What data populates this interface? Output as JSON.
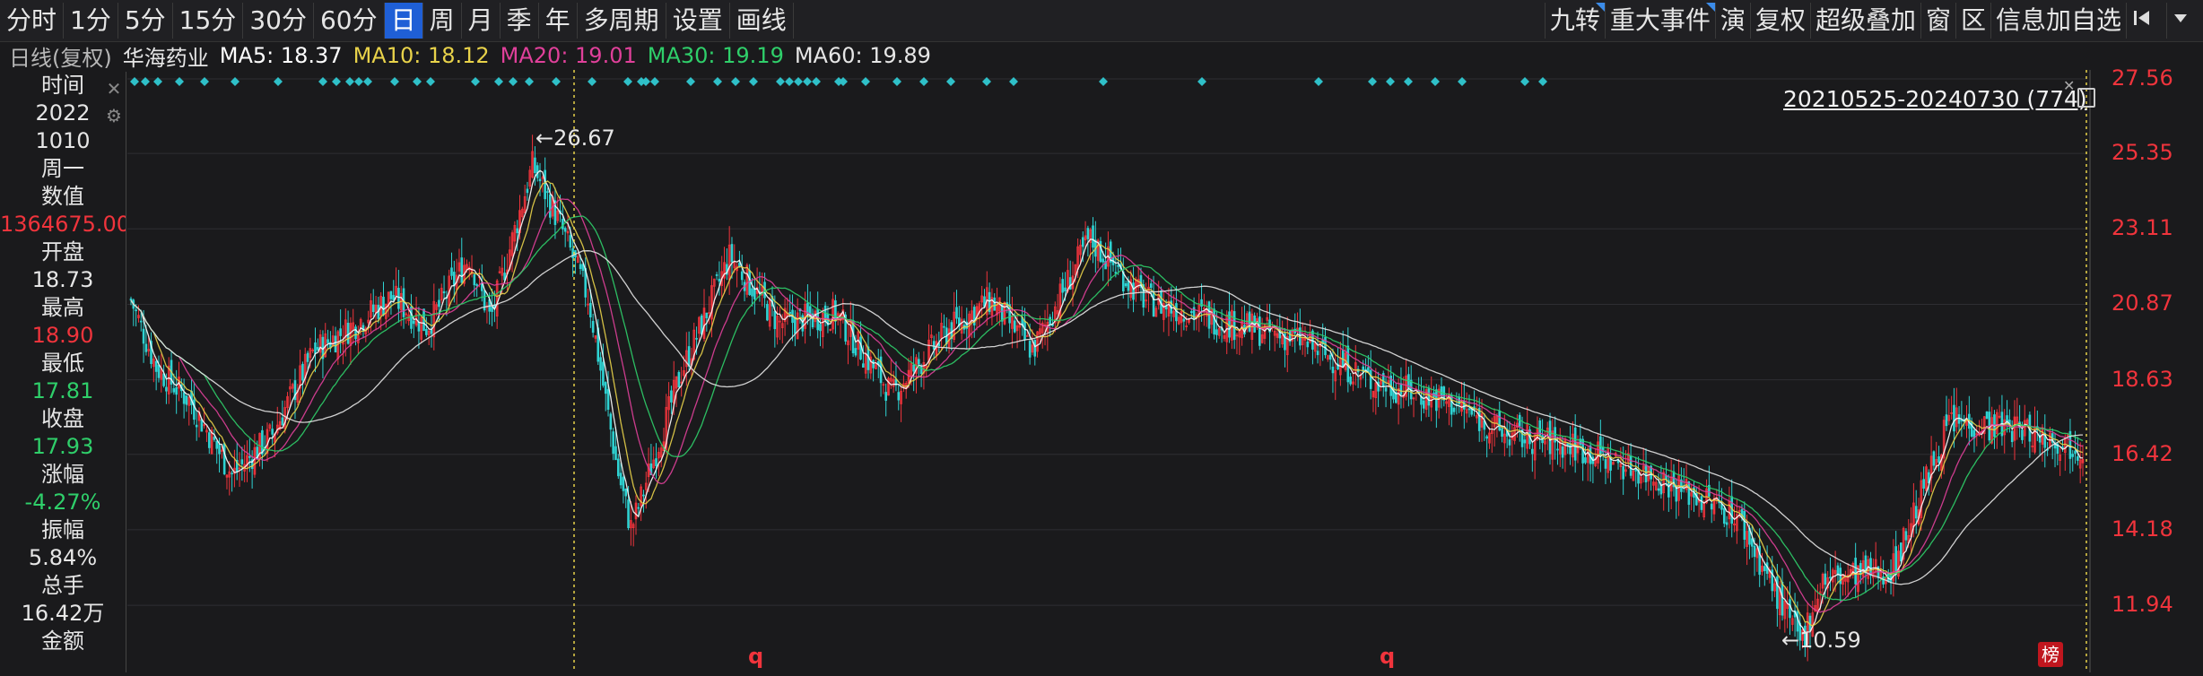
{
  "toolbar": {
    "left": [
      "分时",
      "1分",
      "5分",
      "15分",
      "30分",
      "60分",
      "日",
      "周",
      "月",
      "季",
      "年",
      "多周期",
      "设置",
      "画线"
    ],
    "active": "日",
    "right": [
      "九转",
      "重大事件",
      "演",
      "复权",
      "超级叠加",
      "窗",
      "区",
      "信息加自选"
    ]
  },
  "maline": {
    "period": "日线(复权)",
    "stock": "华海药业",
    "ma5": "MA5: 18.37",
    "ma10": "MA10: 18.12",
    "ma20": "MA20: 19.01",
    "ma30": "MA30: 19.19",
    "ma60": "MA60: 19.89"
  },
  "panel": {
    "time_label": "时间",
    "year": "2022",
    "date": "1010",
    "weekday": "周一",
    "value_label": "数值",
    "value": "1364675.00",
    "open_label": "开盘",
    "open": "18.73",
    "high_label": "最高",
    "high": "18.90",
    "low_label": "最低",
    "low": "17.81",
    "close_label": "收盘",
    "close": "17.93",
    "change_label": "涨幅",
    "change": "-4.27%",
    "amplitude_label": "振幅",
    "amplitude": "5.84%",
    "volume_label": "总手",
    "volume": "16.42万",
    "amount_label": "金额"
  },
  "range_label": "20210525-20240730 (774)",
  "annotations": {
    "high": "26.67",
    "low": "10.59"
  },
  "markers": {
    "q": "q",
    "bang": "榜"
  },
  "colors": {
    "up": "#f0343c",
    "down": "#2fd3d3",
    "ma5": "#ffffff",
    "ma10": "#e8d24a",
    "ma20": "#e0409a",
    "ma30": "#2fcf6a",
    "ma60": "#e6e6e6"
  },
  "chart_data": {
    "type": "candlestick",
    "ylim": [
      10.0,
      27.56
    ],
    "yticks": [
      27.56,
      25.35,
      23.11,
      20.87,
      18.63,
      16.42,
      14.18,
      11.94
    ],
    "points": [
      {
        "x": 0,
        "y": 21.0
      },
      {
        "x": 18,
        "y": 19.0
      },
      {
        "x": 42,
        "y": 18.0
      },
      {
        "x": 72,
        "y": 15.8
      },
      {
        "x": 100,
        "y": 17.0
      },
      {
        "x": 130,
        "y": 19.5
      },
      {
        "x": 160,
        "y": 20.3
      },
      {
        "x": 185,
        "y": 21.1
      },
      {
        "x": 210,
        "y": 20.2
      },
      {
        "x": 240,
        "y": 22.3
      },
      {
        "x": 255,
        "y": 20.4
      },
      {
        "x": 285,
        "y": 25.0
      },
      {
        "x": 305,
        "y": 23.2
      },
      {
        "x": 325,
        "y": 21.0
      },
      {
        "x": 345,
        "y": 16.0
      },
      {
        "x": 355,
        "y": 14.2
      },
      {
        "x": 390,
        "y": 18.8
      },
      {
        "x": 425,
        "y": 22.3
      },
      {
        "x": 460,
        "y": 20.3
      },
      {
        "x": 500,
        "y": 20.6
      },
      {
        "x": 540,
        "y": 18.2
      },
      {
        "x": 580,
        "y": 20.1
      },
      {
        "x": 610,
        "y": 21.0
      },
      {
        "x": 640,
        "y": 19.5
      },
      {
        "x": 680,
        "y": 22.8
      },
      {
        "x": 720,
        "y": 21.0
      },
      {
        "x": 780,
        "y": 20.3
      },
      {
        "x": 830,
        "y": 19.8
      },
      {
        "x": 880,
        "y": 18.6
      },
      {
        "x": 940,
        "y": 17.9
      },
      {
        "x": 975,
        "y": 17.0
      },
      {
        "x": 1020,
        "y": 16.7
      },
      {
        "x": 1080,
        "y": 15.8
      },
      {
        "x": 1140,
        "y": 14.6
      },
      {
        "x": 1185,
        "y": 10.8
      },
      {
        "x": 1200,
        "y": 12.7
      },
      {
        "x": 1250,
        "y": 13.0
      },
      {
        "x": 1290,
        "y": 17.4
      },
      {
        "x": 1340,
        "y": 17.2
      },
      {
        "x": 1385,
        "y": 16.6
      }
    ],
    "diamonds_top": true
  }
}
